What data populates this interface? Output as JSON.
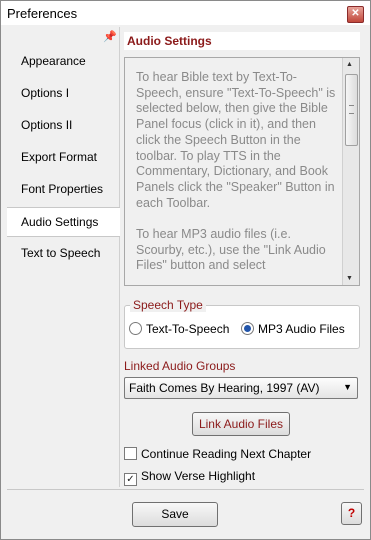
{
  "window": {
    "title": "Preferences"
  },
  "nav": {
    "items": [
      {
        "label": "Appearance",
        "active": false
      },
      {
        "label": "Options I",
        "active": false
      },
      {
        "label": "Options II",
        "active": false
      },
      {
        "label": "Export Format",
        "active": false
      },
      {
        "label": "Font Properties",
        "active": false
      },
      {
        "label": "Audio Settings",
        "active": true
      },
      {
        "label": "Text to Speech",
        "active": false
      }
    ]
  },
  "audio": {
    "section_title": "Audio Settings",
    "info_text": "To hear Bible text by Text-To-Speech, ensure \"Text-To-Speech\" is selected below, then give the Bible Panel focus (click in it), and then click the Speech Button in the toolbar. To play TTS in the Commentary, Dictionary, and Book Panels click the \"Speaker\" Button in each Toolbar.\n\nTo hear MP3 audio files (i.e. Scourby, etc.), use the \"Link Audio Files\" button and select",
    "speech_type": {
      "label": "Speech Type",
      "options": [
        {
          "label": "Text-To-Speech",
          "selected": false
        },
        {
          "label": "MP3 Audio Files",
          "selected": true
        }
      ]
    },
    "linked_groups": {
      "label": "Linked Audio Groups",
      "selected": "Faith Comes By Hearing, 1997 (AV)"
    },
    "link_button": "Link Audio Files",
    "continue_reading": {
      "label": "Continue Reading Next Chapter",
      "checked": false
    },
    "show_highlight": {
      "label": "Show Verse Highlight",
      "checked": true
    }
  },
  "footer": {
    "save_label": "Save",
    "help_label": "?"
  }
}
